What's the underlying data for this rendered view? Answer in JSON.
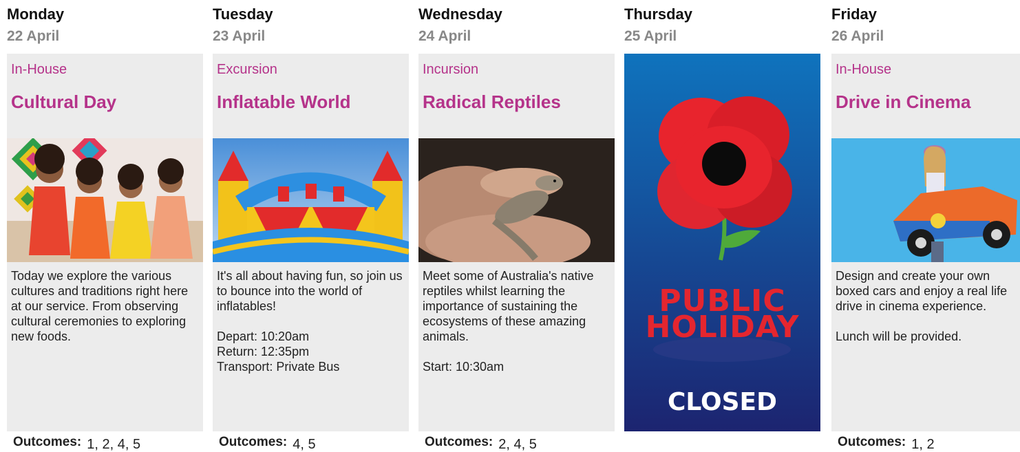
{
  "days": [
    {
      "day": "Monday",
      "date": "22 April",
      "type": "In-House",
      "title": "Cultural Day",
      "description": "Today we explore the various cultures and traditions right here at our service. From observing cultural ceremonies to exploring new foods.",
      "outcomes_label": "Outcomes:",
      "outcomes": "1, 2, 4, 5"
    },
    {
      "day": "Tuesday",
      "date": "23 April",
      "type": "Excursion",
      "title": "Inflatable World",
      "description": "It's all about having fun, so join us to bounce into the world of inflatables!\n\nDepart: 10:20am\nReturn: 12:35pm\nTransport: Private Bus",
      "outcomes_label": "Outcomes:",
      "outcomes": "4, 5"
    },
    {
      "day": "Wednesday",
      "date": "24 April",
      "type": "Incursion",
      "title": "Radical Reptiles",
      "description": "Meet some of Australia's native reptiles whilst learning the importance of sustaining the ecosystems of these amazing animals.\n\nStart: 10:30am",
      "outcomes_label": "Outcomes:",
      "outcomes": "2, 4, 5"
    },
    {
      "day": "Thursday",
      "date": "25 April",
      "holiday_line1": "PUBLIC",
      "holiday_line2": "HOLIDAY",
      "closed": "CLOSED"
    },
    {
      "day": "Friday",
      "date": "26 April",
      "type": "In-House",
      "title": "Drive in Cinema",
      "description": "Design and create your own boxed cars and enjoy a real life drive in cinema experience.\n\nLunch will be provided.",
      "outcomes_label": "Outcomes:",
      "outcomes": "1, 2"
    }
  ],
  "colors": {
    "accent": "#b5338a",
    "card_bg": "#ececec",
    "date_grey": "#888888",
    "holiday_red": "#e4262f",
    "holiday_blue_top": "#0f73bd",
    "holiday_blue_bottom": "#1c2470"
  }
}
